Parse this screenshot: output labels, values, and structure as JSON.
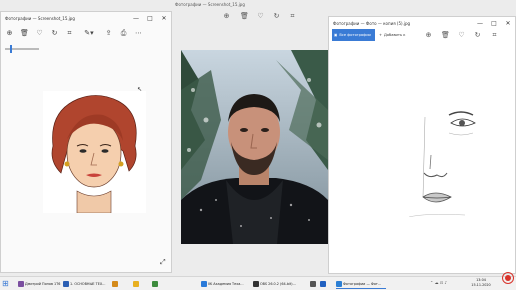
{
  "background_window": {
    "title": "Фотографии — Screenshot_15.jpg"
  },
  "left_window": {
    "title": "Фотографии — Screenshot_15.jpg",
    "caption": {
      "minimize": "—",
      "maximize": "□",
      "close": "✕"
    },
    "toolbar_icons": [
      "zoom-in-icon",
      "delete-icon",
      "favorite-icon",
      "rotate-icon",
      "crop-icon",
      "edit-icon",
      "share-icon",
      "print-icon",
      "more-icon"
    ]
  },
  "right_window": {
    "title": "Фотографии — Фото — копия (5).jpg",
    "tab_all_photos": "Все фотографии",
    "tab_add_to": "Добавить к",
    "caption": {
      "minimize": "—",
      "maximize": "□",
      "close": "✕"
    }
  },
  "taskbar": {
    "items": [
      {
        "label": "Дмитрий Попов 1Т6"
      },
      {
        "label": "1. ОСНОВНЫЕ ТЕХ..."
      },
      {
        "label": ""
      },
      {
        "label": ""
      },
      {
        "label": ""
      },
      {
        "label": "IIK Академия Теха..."
      },
      {
        "label": "OBS 26.0.2 (64-bit)..."
      },
      {
        "label": ""
      },
      {
        "label": ""
      },
      {
        "label": "Фотографии — Фот..."
      }
    ],
    "time": "13:04",
    "date": "15.11.2020"
  },
  "colors": {
    "accent": "#3a7bd5",
    "rec": "#d9332b"
  }
}
